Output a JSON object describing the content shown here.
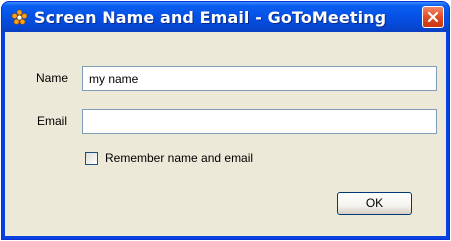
{
  "window": {
    "title": "Screen Name and Email - GoToMeeting",
    "title_icon": "gotomeeting-flower-icon",
    "close_icon": "close-icon"
  },
  "form": {
    "name_label": "Name",
    "name_value": "my name",
    "email_label": "Email",
    "email_value": "",
    "remember_label": "Remember name and email",
    "remember_checked": false
  },
  "buttons": {
    "ok_label": "OK"
  },
  "colors": {
    "titlebar": "#0552e6",
    "client_bg": "#ece9d8",
    "close_button": "#e2502a",
    "icon_orange": "#f7a21b"
  }
}
